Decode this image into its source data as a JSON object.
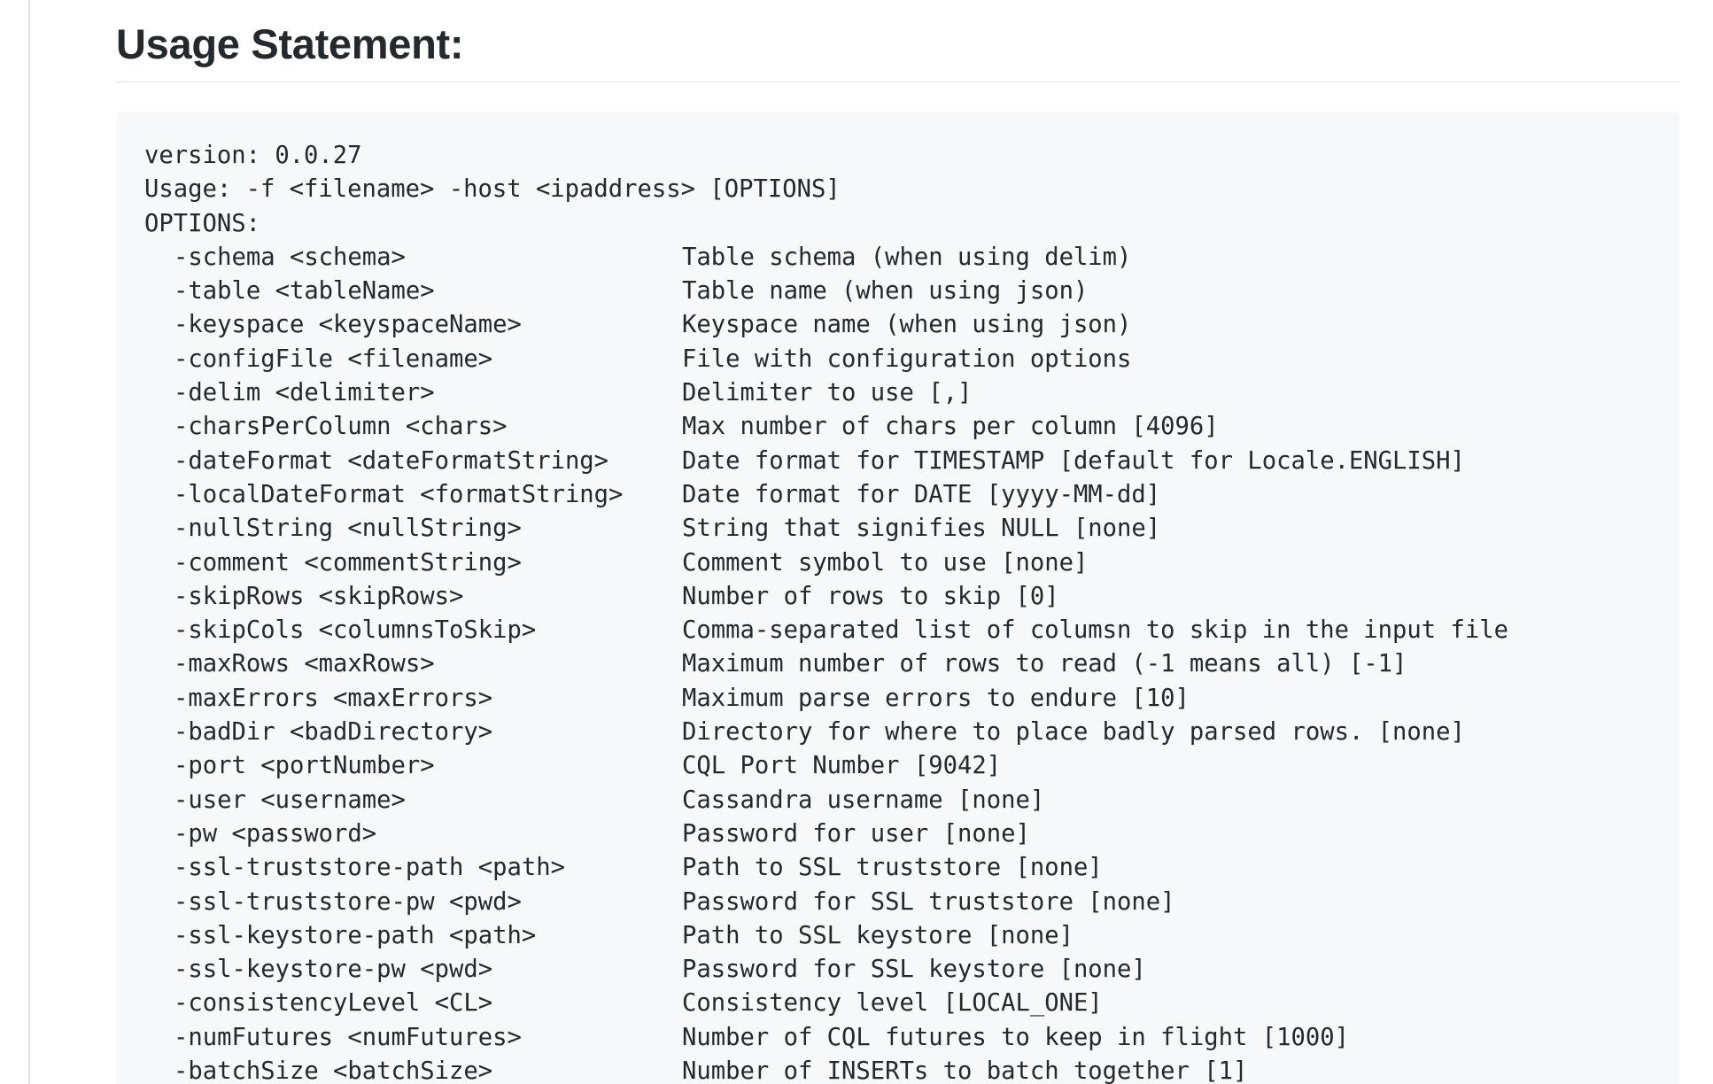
{
  "heading": "Usage Statement:",
  "code": {
    "version_line": "version: 0.0.27",
    "usage_line": "Usage: -f <filename> -host <ipaddress> [OPTIONS]",
    "options_header": "OPTIONS:",
    "options": [
      {
        "flag": "-schema <schema>",
        "desc": "Table schema (when using delim)"
      },
      {
        "flag": "-table <tableName>",
        "desc": "Table name (when using json)"
      },
      {
        "flag": "-keyspace <keyspaceName>",
        "desc": "Keyspace name (when using json)"
      },
      {
        "flag": "-configFile <filename>",
        "desc": "File with configuration options"
      },
      {
        "flag": "-delim <delimiter>",
        "desc": "Delimiter to use [,]"
      },
      {
        "flag": "-charsPerColumn <chars>",
        "desc": "Max number of chars per column [4096]"
      },
      {
        "flag": "-dateFormat <dateFormatString>",
        "desc": "Date format for TIMESTAMP [default for Locale.ENGLISH]"
      },
      {
        "flag": "-localDateFormat <formatString>",
        "desc": "Date format for DATE [yyyy-MM-dd]"
      },
      {
        "flag": "-nullString <nullString>",
        "desc": "String that signifies NULL [none]"
      },
      {
        "flag": "-comment <commentString>",
        "desc": "Comment symbol to use [none]"
      },
      {
        "flag": "-skipRows <skipRows>",
        "desc": "Number of rows to skip [0]"
      },
      {
        "flag": "-skipCols <columnsToSkip>",
        "desc": "Comma-separated list of columsn to skip in the input file"
      },
      {
        "flag": "-maxRows <maxRows>",
        "desc": "Maximum number of rows to read (-1 means all) [-1]"
      },
      {
        "flag": "-maxErrors <maxErrors>",
        "desc": "Maximum parse errors to endure [10]"
      },
      {
        "flag": "-badDir <badDirectory>",
        "desc": "Directory for where to place badly parsed rows. [none]"
      },
      {
        "flag": "-port <portNumber>",
        "desc": "CQL Port Number [9042]"
      },
      {
        "flag": "-user <username>",
        "desc": "Cassandra username [none]"
      },
      {
        "flag": "-pw <password>",
        "desc": "Password for user [none]"
      },
      {
        "flag": "-ssl-truststore-path <path>",
        "desc": "Path to SSL truststore [none]"
      },
      {
        "flag": "-ssl-truststore-pw <pwd>",
        "desc": "Password for SSL truststore [none]"
      },
      {
        "flag": "-ssl-keystore-path <path>",
        "desc": "Path to SSL keystore [none]"
      },
      {
        "flag": "-ssl-keystore-pw <pwd>",
        "desc": "Password for SSL keystore [none]"
      },
      {
        "flag": "-consistencyLevel <CL>",
        "desc": "Consistency level [LOCAL_ONE]"
      },
      {
        "flag": "-numFutures <numFutures>",
        "desc": "Number of CQL futures to keep in flight [1000]"
      },
      {
        "flag": "-batchSize <batchSize>",
        "desc": "Number of INSERTs to batch together [1]"
      }
    ]
  }
}
